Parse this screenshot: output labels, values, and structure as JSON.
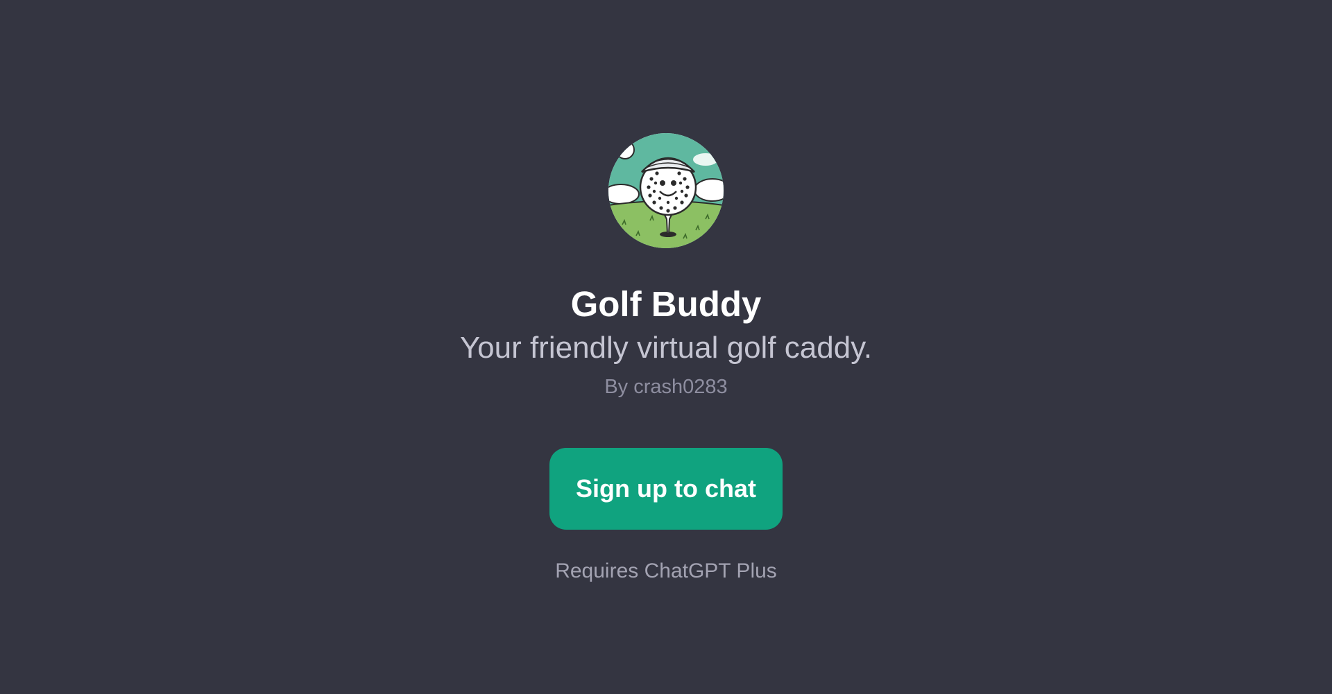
{
  "gpt": {
    "name": "Golf Buddy",
    "description": "Your friendly virtual golf caddy.",
    "author": "By crash0283",
    "avatar_icon": "golf-ball-mascot"
  },
  "actions": {
    "signup_label": "Sign up to chat"
  },
  "footer": {
    "requirement": "Requires ChatGPT Plus"
  },
  "colors": {
    "background": "#343541",
    "accent": "#10a37f",
    "title": "#ffffff",
    "subtitle": "#c5c5d2",
    "muted": "#8e8ea0"
  }
}
